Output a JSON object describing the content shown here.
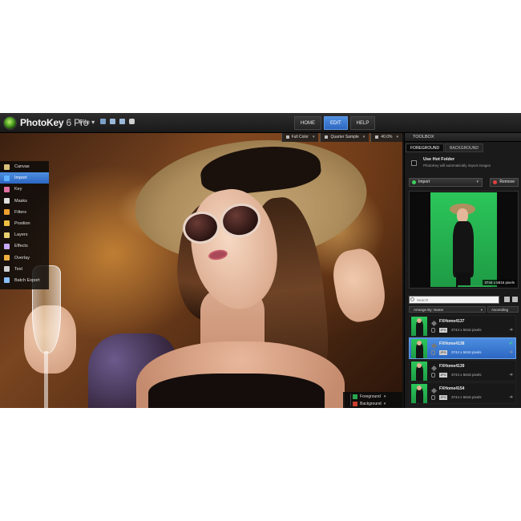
{
  "app": {
    "name": "PhotoKey",
    "version": "6 Pro",
    "file_menu": "File",
    "file_caret": "▾"
  },
  "nav_tabs": [
    {
      "label": "HOME",
      "active": false
    },
    {
      "label": "EDIT",
      "active": true
    },
    {
      "label": "HELP",
      "active": false
    }
  ],
  "canvas_toolbar": {
    "color_mode": "Full Color",
    "sample": "Quarter Sample",
    "zoom": "40.0%",
    "caret": "▾"
  },
  "tools": [
    {
      "label": "Canvas",
      "icon": "canvas-icon",
      "color": "#d9c07a",
      "active": false
    },
    {
      "label": "Import",
      "icon": "import-icon",
      "color": "#5fb0ff",
      "active": true
    },
    {
      "label": "Key",
      "icon": "key-icon",
      "color": "#e070a0",
      "active": false
    },
    {
      "label": "Masks",
      "icon": "masks-icon",
      "color": "#e0e0e0",
      "active": false
    },
    {
      "label": "Filters",
      "icon": "filters-icon",
      "color": "#f0a030",
      "active": false
    },
    {
      "label": "Position",
      "icon": "position-icon",
      "color": "#f0c040",
      "active": false
    },
    {
      "label": "Layers",
      "icon": "layers-icon",
      "color": "#e8d070",
      "active": false
    },
    {
      "label": "Effects",
      "icon": "effects-icon",
      "color": "#c8a8ff",
      "active": false
    },
    {
      "label": "Overlay",
      "icon": "overlay-icon",
      "color": "#f0b040",
      "active": false
    },
    {
      "label": "Text",
      "icon": "text-icon",
      "color": "#d0d0d0",
      "active": false
    },
    {
      "label": "Batch Export",
      "icon": "batch-export-icon",
      "color": "#8ac0ff",
      "active": false
    }
  ],
  "layer_toggle": {
    "foreground": "Foreground",
    "background": "Background",
    "foreground_color": "#2aa84f",
    "background_color": "#c84030",
    "caret": "▾"
  },
  "toolbox": {
    "title": "TOOLBOX",
    "tabs": [
      {
        "label": "FOREGROUND",
        "active": true
      },
      {
        "label": "BACKGROUND",
        "active": false
      }
    ],
    "hot_folder": {
      "title": "Use Hot Folder",
      "description": "PhotoKey will automatically import images"
    },
    "import_label": "Import",
    "remove_label": "Remove",
    "caret": "▾",
    "preview_size": "3744 x 5616 pixels",
    "search_placeholder": "Search",
    "arrange_label": "Arrange By: Name",
    "order_label": "Ascending",
    "files": [
      {
        "name": "FXHome4137",
        "format": "JPG",
        "size": "3744 x 5616 pixels",
        "active": false
      },
      {
        "name": "FXHome4138",
        "format": "JPG",
        "size": "3744 x 5616 pixels",
        "active": true
      },
      {
        "name": "FXHome4139",
        "format": "JPG",
        "size": "3744 x 5616 pixels",
        "active": false
      },
      {
        "name": "FXHome4154",
        "format": "JPG",
        "size": "3744 x 5616 pixels",
        "active": false
      }
    ],
    "arrow": "➜",
    "check": "✔"
  },
  "colors": {
    "accent": "#3a7bd5",
    "green_screen": "#2cc65a"
  }
}
